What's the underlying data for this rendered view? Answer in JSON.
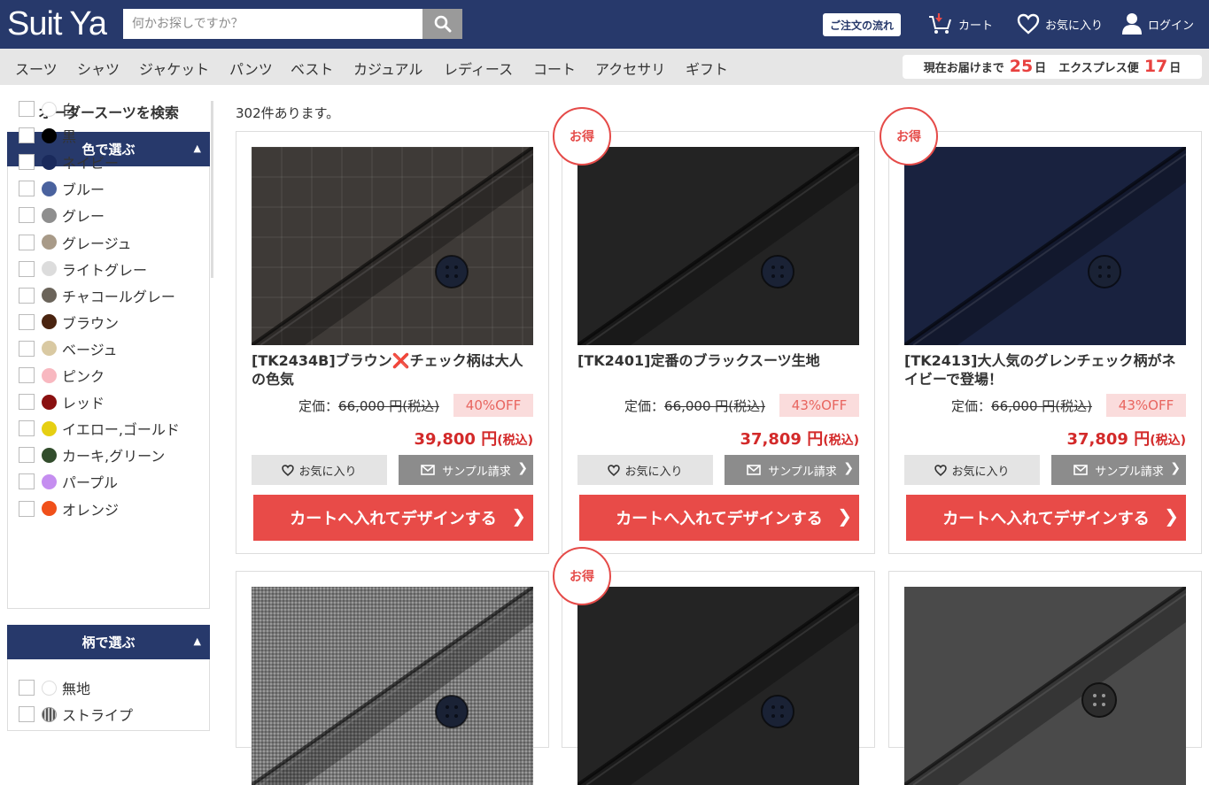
{
  "header": {
    "logo": "Suit Ya",
    "search_placeholder": "何かお探しですか？",
    "order_flow": "ご注文の流れ",
    "cart": "カート",
    "favorites": "お気に入り",
    "login": "ログイン"
  },
  "categories": [
    "スーツ",
    "シャツ",
    "ジャケット",
    "パンツ",
    "ベスト",
    "カジュアル",
    "レディース",
    "コート",
    "アクセサリ",
    "ギフト"
  ],
  "delivery": {
    "label1": "現在お届けまで",
    "days1": "25",
    "unit1": "日",
    "label2": "エクスプレス便",
    "days2": "17",
    "unit2": "日"
  },
  "sidebar": {
    "title": "オーダースーツを検索",
    "color_facet": {
      "heading": "色で選ぶ",
      "items": [
        {
          "label": "白",
          "color": "#ffffff"
        },
        {
          "label": "黒",
          "color": "#000000"
        },
        {
          "label": "ネイビー",
          "color": "#1a2a5c"
        },
        {
          "label": "ブルー",
          "color": "#4a629e"
        },
        {
          "label": "グレー",
          "color": "#8e8e8e"
        },
        {
          "label": "グレージュ",
          "color": "#a89a88"
        },
        {
          "label": "ライトグレー",
          "color": "#dcdcdc"
        },
        {
          "label": "チャコールグレー",
          "color": "#6b645a"
        },
        {
          "label": "ブラウン",
          "color": "#4a2410"
        },
        {
          "label": "ベージュ",
          "color": "#d9c9a2"
        },
        {
          "label": "ピンク",
          "color": "#f8b8c0"
        },
        {
          "label": "レッド",
          "color": "#8a1010"
        },
        {
          "label": "イエロー,ゴールド",
          "color": "#e6cf12"
        },
        {
          "label": "カーキ,グリーン",
          "color": "#324d2c"
        },
        {
          "label": "パープル",
          "color": "#c58ef0"
        },
        {
          "label": "オレンジ",
          "color": "#f0501a"
        }
      ]
    },
    "pattern_facet": {
      "heading": "柄で選ぶ",
      "items": [
        {
          "label": "無地"
        },
        {
          "label": "ストライプ"
        }
      ]
    }
  },
  "results": {
    "count_text": "302件あります。",
    "products": [
      {
        "title": "[TK2434B]ブラウン❌チェック柄は大人の色気",
        "badge": "",
        "list_price_label": "定価：",
        "list_price": "66,000 円(税込)",
        "off": "40%OFF",
        "sale_price": "39,800 円",
        "sale_suffix": "(税込)",
        "fabric_color": "#3e3a37"
      },
      {
        "title": "[TK2401]定番のブラックスーツ生地",
        "badge": "お得",
        "list_price_label": "定価：",
        "list_price": "66,000 円(税込)",
        "off": "43%OFF",
        "sale_price": "37,809 円",
        "sale_suffix": "(税込)",
        "fabric_color": "#232323"
      },
      {
        "title": "[TK2413]大人気のグレンチェック柄がネイビーで登場！",
        "badge": "お得",
        "list_price_label": "定価：",
        "list_price": "66,000 円(税込)",
        "off": "43%OFF",
        "sale_price": "37,809 円",
        "sale_suffix": "(税込)",
        "fabric_color": "#19223f"
      },
      {
        "title": "",
        "badge": "",
        "fabric_color": "#9a9a9a"
      },
      {
        "title": "",
        "badge": "お得",
        "fabric_color": "#242424"
      },
      {
        "title": "",
        "badge": "",
        "fabric_color": "#4a4a4a"
      }
    ],
    "buttons": {
      "favorite": "お気に入り",
      "sample": "サンプル請求",
      "cart": "カートへ入れてデザインする"
    }
  }
}
